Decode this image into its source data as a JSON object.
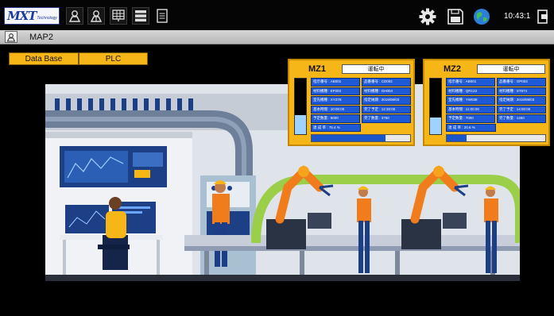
{
  "app": {
    "logo_text": "MXT",
    "logo_subtext": "Technology",
    "time": "10:43:1"
  },
  "toolbar": {
    "icons": [
      "users-icon",
      "user-group-icon",
      "monitor-grid-icon",
      "list-icon",
      "document-icon"
    ],
    "right_icons": [
      "gear-icon",
      "floppy-icon",
      "globe-icon",
      "logout-icon"
    ]
  },
  "page": {
    "title": "MAP2"
  },
  "nav": {
    "database_label": "Data Base",
    "plc_label": "PLC"
  },
  "machines": [
    {
      "name": "MZ1",
      "status": "運転中",
      "level_fraction": 0.35,
      "progress_fraction": 0.75,
      "rows": [
        [
          "指示番号 : AB001",
          "品番番号 : CD002"
        ],
        [
          "材料機種 : EF003",
          "材料機種 : GH004"
        ],
        [
          "室先機種 : XYZ78",
          "指定納期 : 2019/08/03"
        ],
        [
          "基本時間 : 10:00:00",
          "完了予定 : 12:30:00"
        ],
        [
          "予定数量 : 5000",
          "完了数量 : 3750"
        ],
        [
          "達 成 率 : 75.4 %",
          ""
        ]
      ]
    },
    {
      "name": "MZ2",
      "status": "運転中",
      "level_fraction": 0.3,
      "progress_fraction": 0.2,
      "rows": [
        [
          "指示番号 : AB001",
          "品番番号 : OP003"
        ],
        [
          "材料機種 : QR123",
          "材料機種 : ST674"
        ],
        [
          "室先機種 : YW038",
          "指定納期 : 2019/08/03"
        ],
        [
          "基本時間 : 11:00:00",
          "完了予定 : 14:00:00"
        ],
        [
          "予定数量 : 7000",
          "完了数量 : 1450"
        ],
        [
          "達 成 率 : 20.6 %",
          ""
        ]
      ]
    }
  ],
  "colors": {
    "accent": "#f7b617",
    "panel_blue": "#1f5ad6",
    "background": "#000000"
  }
}
